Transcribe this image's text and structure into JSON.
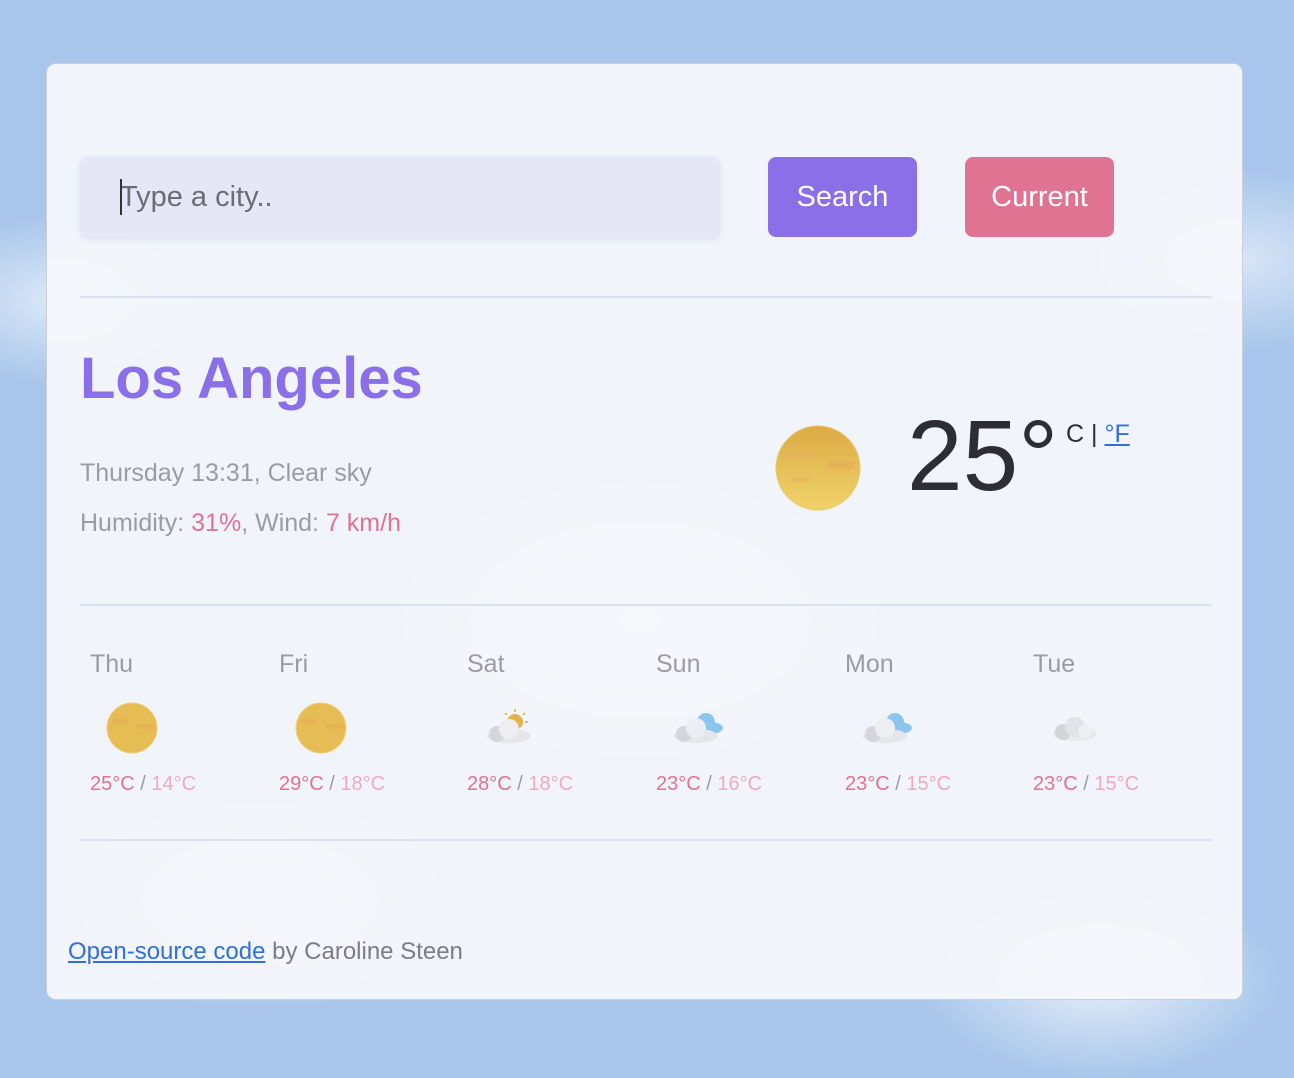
{
  "search": {
    "placeholder": "Type a city..",
    "search_label": "Search",
    "current_label": "Current"
  },
  "weather": {
    "city": "Los Angeles",
    "day_time": "Thursday 13:31",
    "condition": "Clear sky",
    "humidity_label": "Humidity:",
    "humidity": "31%",
    "wind_label": "Wind:",
    "wind": "7 km/h",
    "temperature": "25°",
    "unit_c": "C",
    "unit_sep": "|",
    "unit_f": "°F",
    "icon": "sun-icon"
  },
  "forecast": [
    {
      "day": "Thu",
      "max": "25°C",
      "min": "14°C",
      "icon": "sun-icon"
    },
    {
      "day": "Fri",
      "max": "29°C",
      "min": "18°C",
      "icon": "sun-icon"
    },
    {
      "day": "Sat",
      "max": "28°C",
      "min": "18°C",
      "icon": "partly-cloudy-icon"
    },
    {
      "day": "Sun",
      "max": "23°C",
      "min": "16°C",
      "icon": "cloudy-icon"
    },
    {
      "day": "Mon",
      "max": "23°C",
      "min": "15°C",
      "icon": "cloudy-icon"
    },
    {
      "day": "Tue",
      "max": "23°C",
      "min": "15°C",
      "icon": "grey-cloud-icon"
    }
  ],
  "footer": {
    "link_text": "Open-source code",
    "text": "by Caroline Steen"
  },
  "colors": {
    "accent": "#8a6fe8",
    "pink": "#e07292",
    "link": "#2f6fe0"
  }
}
